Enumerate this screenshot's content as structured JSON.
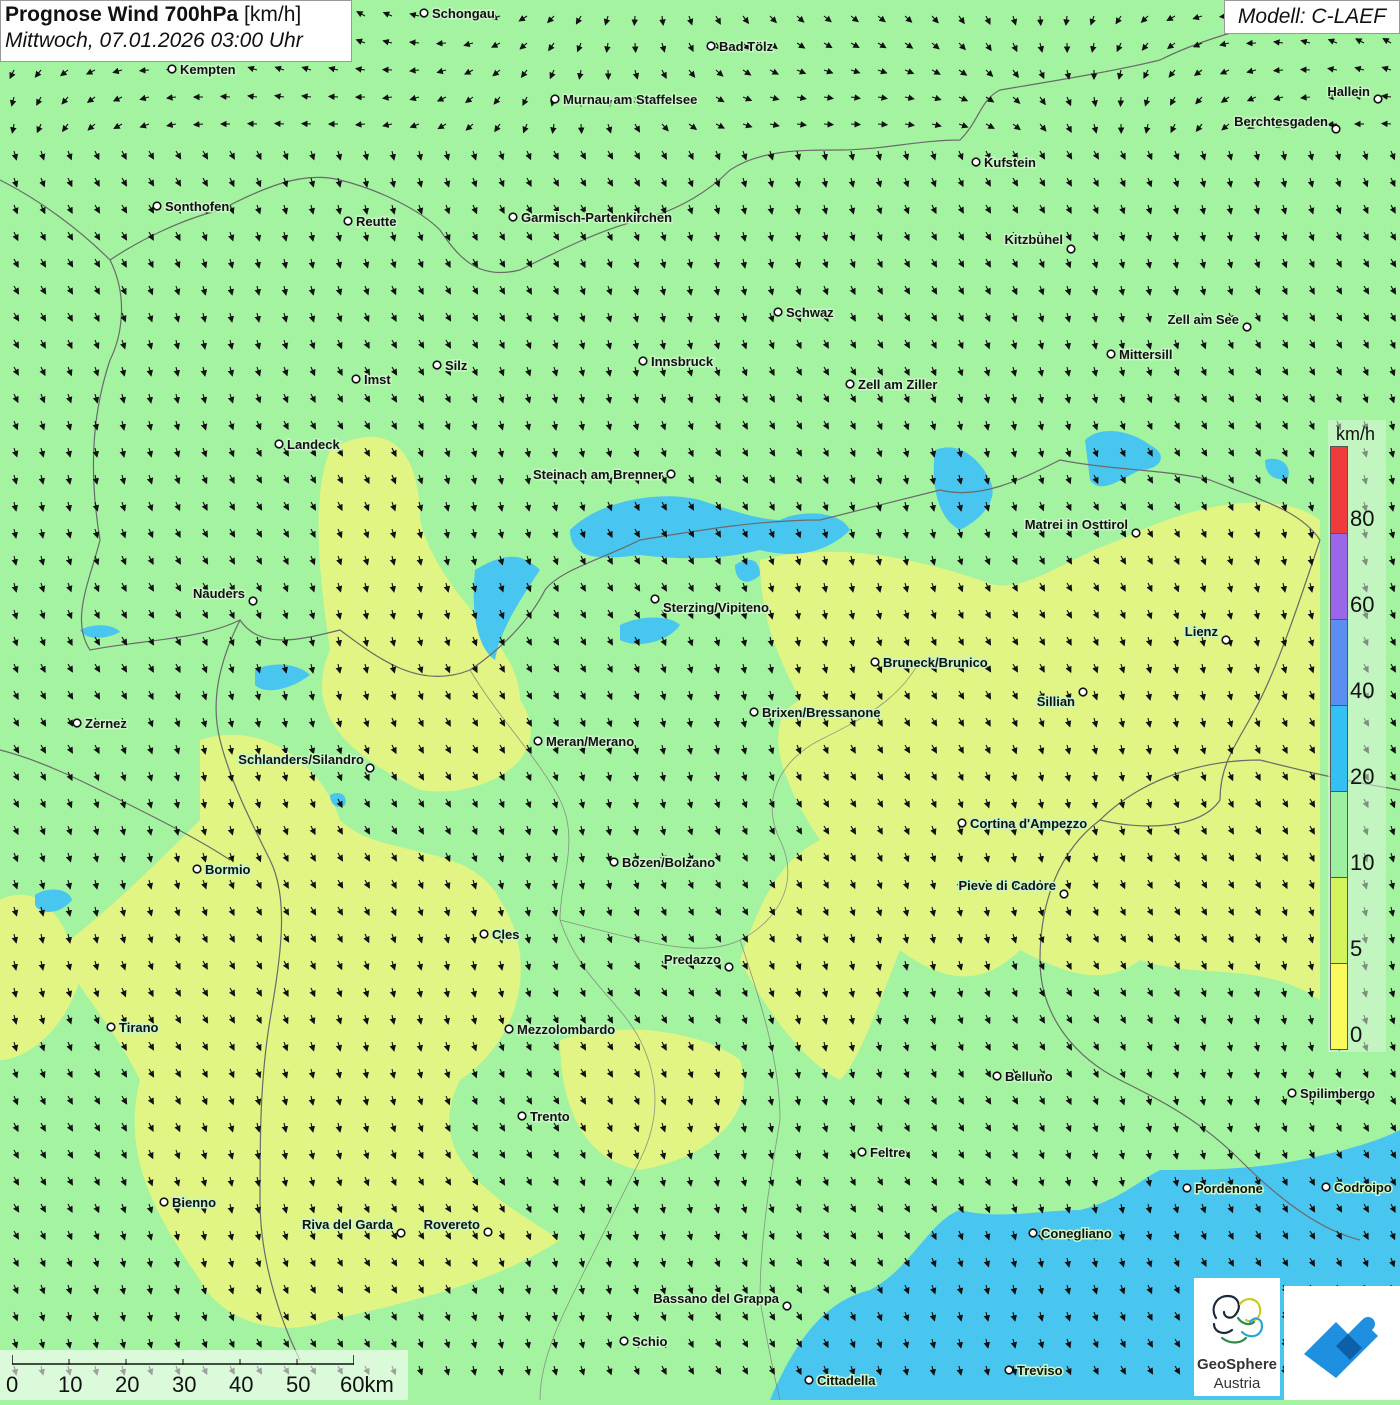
{
  "title": {
    "bold": "Prognose Wind 700hPa",
    "unit": "[km/h]",
    "datetime": "Mittwoch, 07.01.2026 03:00 Uhr"
  },
  "model": "Modell: C-LAEF",
  "legend": {
    "unit": "km/h",
    "ticks": [
      "80",
      "60",
      "40",
      "20",
      "10",
      "5",
      "0"
    ],
    "colors": [
      "#ef3b3b",
      "#9a66ea",
      "#5b8ef0",
      "#34c0f3",
      "#9df0a0",
      "#d4f45e",
      "#fafa5c"
    ]
  },
  "scalebar": {
    "labels": [
      "0",
      "10",
      "20",
      "30",
      "40",
      "50",
      "60km"
    ]
  },
  "logo": {
    "name_line1": "GeoSphere",
    "name_line2": "Austria"
  },
  "colors": {
    "background": "#a4f3a0",
    "calm_yellow": "#e8f581",
    "wind_blue": "#49c6f0",
    "border_line": "#6a6a6a",
    "arrow": "#111111"
  },
  "cities": [
    "Schongau",
    "Bad Tölz",
    "Kempten",
    "Murnau am Staffelsee",
    "Hallein",
    "Berchtesgaden",
    "Kufstein",
    "Sonthofen",
    "Reutte",
    "Garmisch-Partenkirchen",
    "Kitzbühel",
    "Schwaz",
    "Zell am See",
    "Innsbruck",
    "Mittersill",
    "Silz",
    "Imst",
    "Zell am Ziller",
    "Landeck",
    "Steinach am Brenner",
    "Matrei in Osttirol",
    "Nauders",
    "Sterzing/Vipiteno",
    "Lienz",
    "Bruneck/Brunico",
    "Sillian",
    "Zernez",
    "Brixen/Bressanone",
    "Meran/Merano",
    "Schlanders/Silandro",
    "Cortina d'Ampezzo",
    "Bozen/Bolzano",
    "Bormio",
    "Pieve di Cadore",
    "Cles",
    "Predazzo",
    "Tirano",
    "Mezzolombardo",
    "Belluno",
    "Spilimbergo",
    "Trento",
    "Feltre",
    "Pordenone",
    "Codroipo",
    "Bienno",
    "Riva del Garda",
    "Rovereto",
    "Conegliano",
    "Bassano del Grappa",
    "Schio",
    "Treviso",
    "Cittadella"
  ]
}
